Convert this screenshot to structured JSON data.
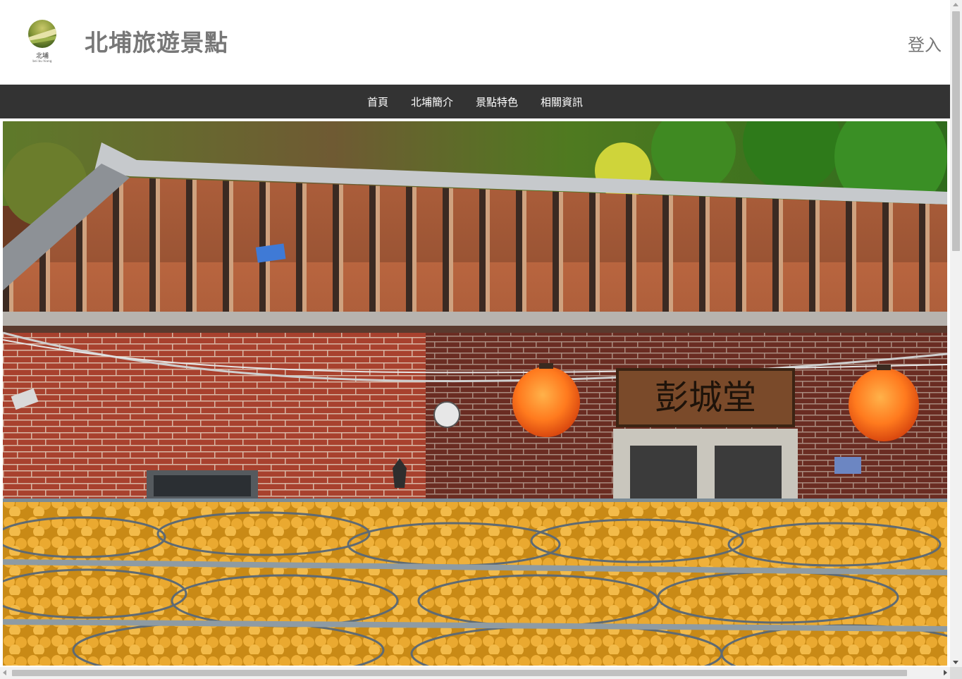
{
  "header": {
    "site_title": "北埔旅遊景點",
    "logo_name": "北埔",
    "logo_sub": "bei bu hiang",
    "login_label": "登入"
  },
  "nav": {
    "items": [
      {
        "label": "首頁"
      },
      {
        "label": "北埔簡介"
      },
      {
        "label": "景點特色"
      },
      {
        "label": "相關資訊"
      }
    ]
  },
  "hero": {
    "sign_text": "彭城堂",
    "icon": "hero-photo-persimmon-drying"
  },
  "colors": {
    "nav_bg": "#333333",
    "title_gray": "#777777"
  }
}
